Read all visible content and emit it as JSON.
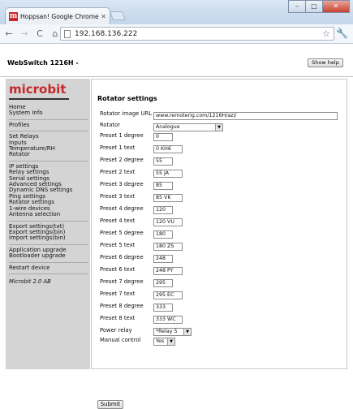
{
  "browser": {
    "tab_title": "Hoppsan! Google Chrome",
    "favicon_letter": "m",
    "url": "192.168.136.222",
    "minimize": "–",
    "maximize": "□",
    "close": "✕",
    "back": "←",
    "forward": "→",
    "reload": "C",
    "home": "⌂",
    "star": "☆",
    "wrench": "🔧"
  },
  "header": {
    "device_title": "WebSwitch 1216H -",
    "help_button": "Show help"
  },
  "sidebar": {
    "logo": "microbit",
    "groups": [
      [
        "Home",
        "System Info"
      ],
      [
        "Profiles"
      ],
      [
        "Set Relays",
        "Inputs",
        "Temperature/RH",
        "Rotator"
      ],
      [
        "IP settings",
        "Relay settings",
        "Serial settings",
        "Advanced settings",
        "Dynamic DNS settings",
        "Ping settings",
        "Rotator settings",
        "1-wire devices",
        "Antenna selection"
      ],
      [
        "Export settings(txt)",
        "Export settings(bin)",
        "Import settings(bin)"
      ],
      [
        "Application upgrade",
        "Bootloader upgrade"
      ],
      [
        "Restart device"
      ]
    ],
    "footer": "Microbit 2.0 AB"
  },
  "content": {
    "section_title": "Rotator settings",
    "image_url_label": "Rotator image URL",
    "image_url_value": "www.remoterig.com/1216H/azi/",
    "rotator_label": "Rotator",
    "rotator_value": "Analogue",
    "presets": [
      {
        "degree_label": "Preset 1 degree",
        "degree": "0",
        "text_label": "Preset 1 text",
        "text": "0 KH6"
      },
      {
        "degree_label": "Preset 2 degree",
        "degree": "55",
        "text_label": "Preset 2 text",
        "text": "55 JA"
      },
      {
        "degree_label": "Preset 3 degree",
        "degree": "85",
        "text_label": "Preset 3 text",
        "text": "85 VK"
      },
      {
        "degree_label": "Preset 4 degree",
        "degree": "120",
        "text_label": "Preset 4 text",
        "text": "120 VU"
      },
      {
        "degree_label": "Preset 5 degree",
        "degree": "180",
        "text_label": "Preset 5 text",
        "text": "180 ZS"
      },
      {
        "degree_label": "Preset 6 degree",
        "degree": "248",
        "text_label": "Preset 6 text",
        "text": "248 PY"
      },
      {
        "degree_label": "Preset 7 degree",
        "degree": "295",
        "text_label": "Preset 7 text",
        "text": "295 EC"
      },
      {
        "degree_label": "Preset 8 degree",
        "degree": "333",
        "text_label": "Preset 8 text",
        "text": "333 WC"
      }
    ],
    "power_relay_label": "Power relay",
    "power_relay_value": "*Relay 5",
    "manual_control_label": "Manual control",
    "manual_control_value": "Yes",
    "submit_label": "Submit"
  },
  "colors": {
    "logo": "#c62828",
    "sidebar_bg": "#d4d4d4"
  }
}
